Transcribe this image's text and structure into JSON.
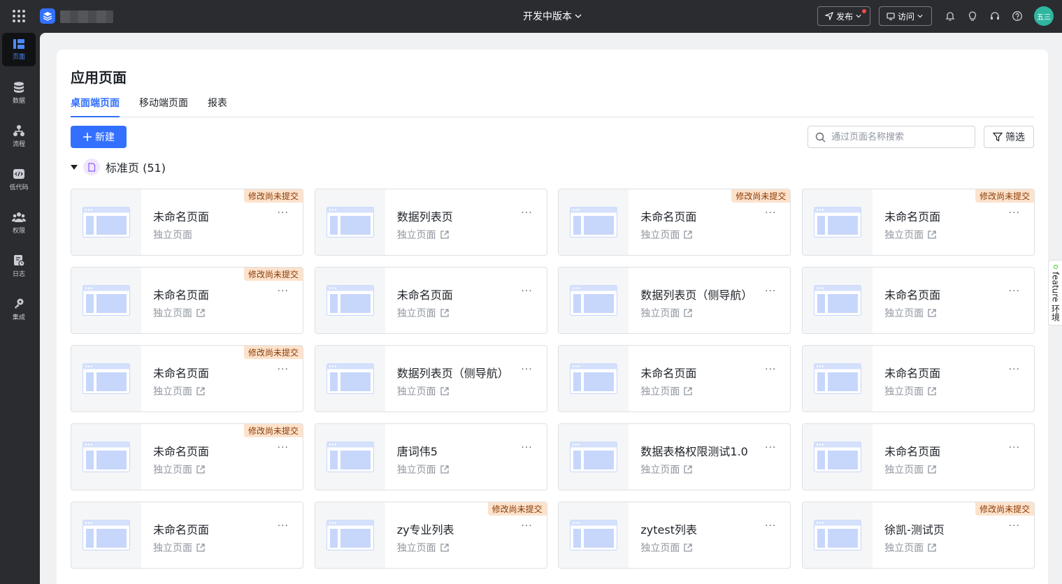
{
  "topbar": {
    "version_label": "开发中版本",
    "publish_label": "发布",
    "visit_label": "访问",
    "avatar_text": "五三"
  },
  "sidebar": {
    "items": [
      {
        "label": "页面",
        "icon": "page-icon"
      },
      {
        "label": "数据",
        "icon": "database-icon"
      },
      {
        "label": "流程",
        "icon": "flow-icon"
      },
      {
        "label": "低代码",
        "icon": "code-icon"
      },
      {
        "label": "权限",
        "icon": "users-icon"
      },
      {
        "label": "日志",
        "icon": "log-icon"
      },
      {
        "label": "集成",
        "icon": "integration-icon"
      }
    ]
  },
  "main": {
    "title": "应用页面",
    "tabs": [
      {
        "label": "桌面端页面"
      },
      {
        "label": "移动端页面"
      },
      {
        "label": "报表"
      }
    ],
    "new_label": "新建",
    "search_placeholder": "通过页面名称搜索",
    "filter_label": "筛选",
    "group_label": "标准页 (51)"
  },
  "cards": [
    {
      "name": "未命名页面",
      "type": "独立页面",
      "badge": "修改尚未提交",
      "ext": false
    },
    {
      "name": "数据列表页",
      "type": "独立页面",
      "badge": "",
      "ext": true
    },
    {
      "name": "未命名页面",
      "type": "独立页面",
      "badge": "修改尚未提交",
      "ext": true
    },
    {
      "name": "未命名页面",
      "type": "独立页面",
      "badge": "修改尚未提交",
      "ext": true
    },
    {
      "name": "未命名页面",
      "type": "独立页面",
      "badge": "修改尚未提交",
      "ext": true
    },
    {
      "name": "未命名页面",
      "type": "独立页面",
      "badge": "",
      "ext": true
    },
    {
      "name": "数据列表页（侧导航）",
      "type": "独立页面",
      "badge": "",
      "ext": true
    },
    {
      "name": "未命名页面",
      "type": "独立页面",
      "badge": "",
      "ext": true
    },
    {
      "name": "未命名页面",
      "type": "独立页面",
      "badge": "修改尚未提交",
      "ext": true
    },
    {
      "name": "数据列表页（侧导航）",
      "type": "独立页面",
      "badge": "",
      "ext": true
    },
    {
      "name": "未命名页面",
      "type": "独立页面",
      "badge": "",
      "ext": true
    },
    {
      "name": "未命名页面",
      "type": "独立页面",
      "badge": "",
      "ext": true
    },
    {
      "name": "未命名页面",
      "type": "独立页面",
      "badge": "修改尚未提交",
      "ext": true
    },
    {
      "name": "唐词伟5",
      "type": "独立页面",
      "badge": "",
      "ext": true
    },
    {
      "name": "数据表格权限测试1.0",
      "type": "独立页面",
      "badge": "",
      "ext": true
    },
    {
      "name": "未命名页面",
      "type": "独立页面",
      "badge": "",
      "ext": true
    },
    {
      "name": "未命名页面",
      "type": "独立页面",
      "badge": "",
      "ext": true
    },
    {
      "name": "zy专业列表",
      "type": "独立页面",
      "badge": "修改尚未提交",
      "ext": true
    },
    {
      "name": "zytest列表",
      "type": "独立页面",
      "badge": "",
      "ext": true
    },
    {
      "name": "徐凯-测试页",
      "type": "独立页面",
      "badge": "修改尚未提交",
      "ext": true
    }
  ],
  "feature_tab": "feature 环境"
}
